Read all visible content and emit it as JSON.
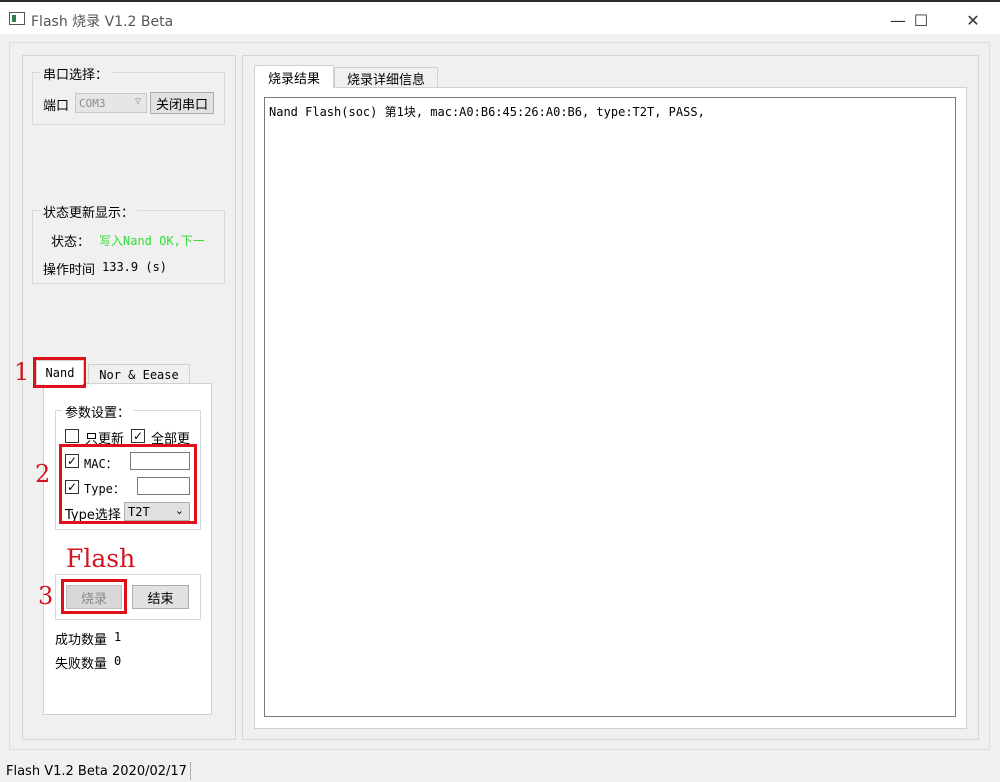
{
  "window": {
    "title": "Flash 烧录  V1.2 Beta",
    "minimize": "—",
    "maximize": "☐",
    "close": "✕"
  },
  "serial": {
    "group_title": "串口选择：",
    "port_label": "端口",
    "port_value": "COM3",
    "close_button": "关闭串口"
  },
  "status": {
    "group_title": "状态更新显示：",
    "status_label": "状态：",
    "status_value": "写入Nand OK,下一",
    "status_color": "#33dd33",
    "time_label": "操作时间",
    "time_value": "133.9 (s)"
  },
  "left_tabs": [
    {
      "label": "Nand",
      "active": true
    },
    {
      "label": "Nor & Eease",
      "active": false
    }
  ],
  "params": {
    "group_title": "参数设置：",
    "update_only": {
      "label": "只更新",
      "checked": false
    },
    "update_all": {
      "label": "全部更",
      "checked": true
    },
    "mac": {
      "label": "MAC：",
      "checked": true,
      "value": ""
    },
    "type": {
      "label": "Type：",
      "checked": true,
      "value": ""
    },
    "type_select_label": "Type选择",
    "type_select_value": "T2T"
  },
  "flash": {
    "burn_button": "烧录",
    "end_button": "结束",
    "success_label": "成功数量",
    "success_count": "1",
    "fail_label": "失败数量",
    "fail_count": "0"
  },
  "right_tabs": [
    {
      "label": "烧录结果",
      "active": true
    },
    {
      "label": "烧录详细信息",
      "active": false
    }
  ],
  "log_lines": [
    "Nand Flash(soc) 第1块, mac:A0:B6:45:26:A0:B6, type:T2T, PASS,"
  ],
  "annotations": {
    "one": "1",
    "two": "2",
    "three": "3",
    "flash": "Flash"
  },
  "statusbar": {
    "text": "Flash  V1.2 Beta  2020/02/17"
  },
  "colors": {
    "annotation_red": "#e0101a"
  }
}
